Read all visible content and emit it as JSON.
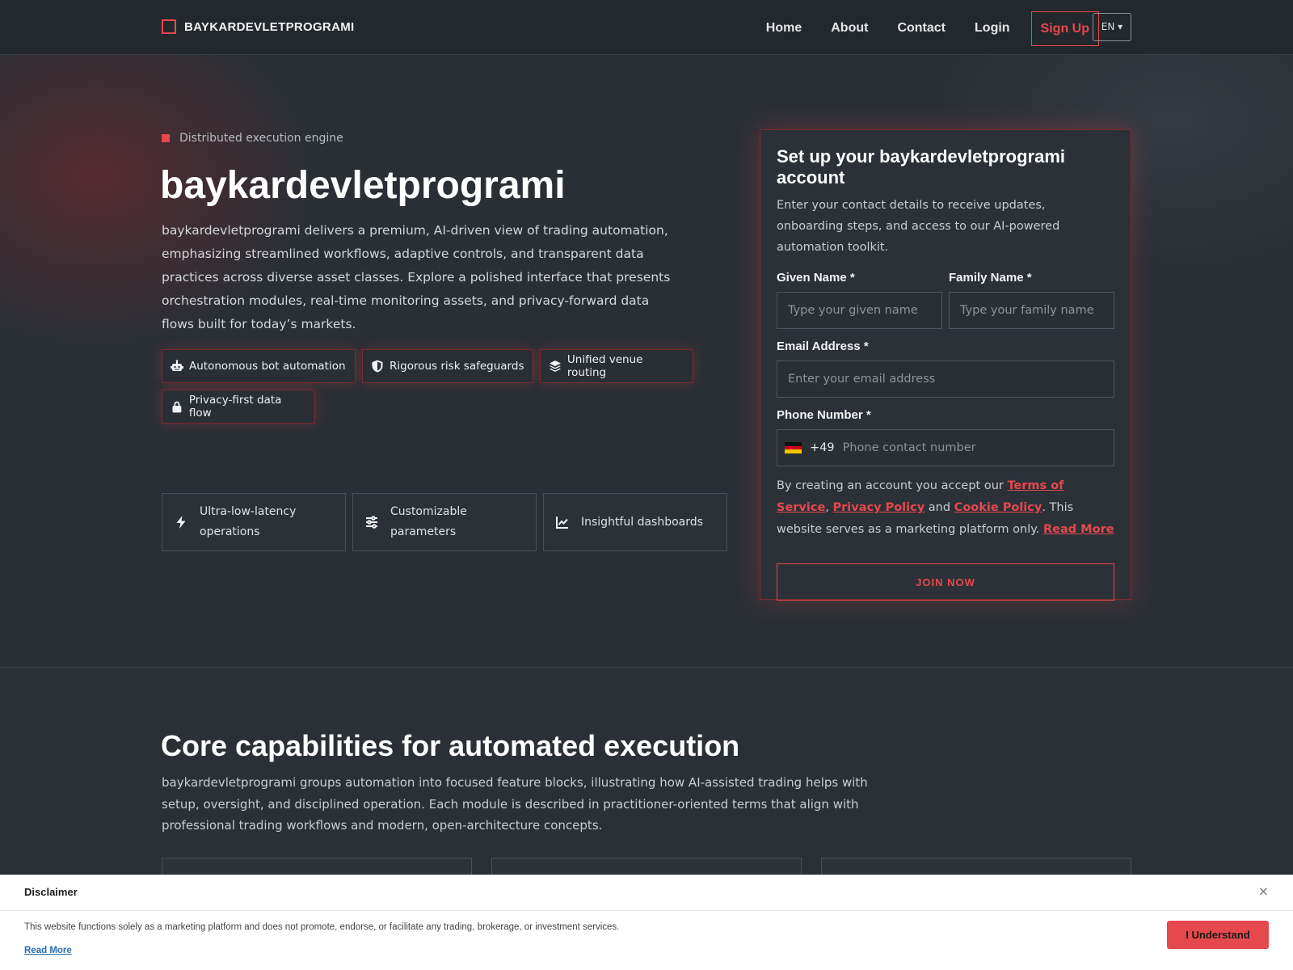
{
  "nav": {
    "brand": "BAYKARDEVLETPROGRAMI",
    "links": [
      "Home",
      "About",
      "Contact",
      "Login"
    ],
    "signup": "Sign Up",
    "language": "EN ▾"
  },
  "hero": {
    "eyebrow": "Distributed execution engine",
    "title": "baykardevletprogrami",
    "description": "baykardevletprogrami delivers a premium, AI-driven view of trading automation, emphasizing streamlined workflows, adaptive controls, and transparent data practices across diverse asset classes. Explore a polished interface that presents orchestration modules, real-time monitoring assets, and privacy-forward data flows built for today’s markets.",
    "chips": [
      {
        "label": "Autonomous bot automation",
        "icon": "robot-icon"
      },
      {
        "label": "Rigorous risk safeguards",
        "icon": "shield-icon"
      },
      {
        "label": "Unified venue routing",
        "icon": "layers-icon"
      },
      {
        "label": "Privacy-first data flow",
        "icon": "lock-icon"
      }
    ],
    "features": [
      {
        "label": "Ultra-low-latency operations",
        "icon": "bolt-icon"
      },
      {
        "label": "Customizable parameters",
        "icon": "sliders-icon"
      },
      {
        "label": "Insightful dashboards",
        "icon": "chart-line-icon"
      }
    ]
  },
  "form": {
    "title": "Set up your baykardevletprogrami account",
    "subtitle": "Enter your contact details to receive updates, onboarding steps, and access to our AI-powered automation toolkit.",
    "given_label": "Given Name *",
    "given_placeholder": "Type your given name",
    "family_label": "Family Name *",
    "family_placeholder": "Type your family name",
    "email_label": "Email Address *",
    "email_placeholder": "Enter your email address",
    "phone_label": "Phone Number *",
    "phone_dial": "+49",
    "phone_placeholder": "Phone contact number",
    "terms_prefix": "By creating an account you accept our ",
    "terms_link": "Terms of Service",
    "terms_comma": ",",
    "privacy_link": "Privacy Policy",
    "terms_and": " and ",
    "cookie_link": "Cookie Policy",
    "terms_suffix": ". This website serves as a marketing platform only. ",
    "read_more": "Read More",
    "submit": "JOIN NOW"
  },
  "section2": {
    "title": "Core capabilities for automated execution",
    "description": "baykardevletprogrami groups automation into focused feature blocks, illustrating how AI-assisted trading helps with setup, oversight, and disciplined operation. Each module is described in practitioner-oriented terms that align with professional trading workflows and modern, open-architecture concepts."
  },
  "disclaimer": {
    "title": "Disclaimer",
    "close": "×",
    "text": "This website functions solely as a marketing platform and does not promote, endorse, or facilitate any trading, brokerage, or investment services.",
    "read_more": "Read More",
    "button": "I Understand"
  },
  "colors": {
    "accent": "#e5484d",
    "background": "#2b3036",
    "nav": "#23282d"
  }
}
